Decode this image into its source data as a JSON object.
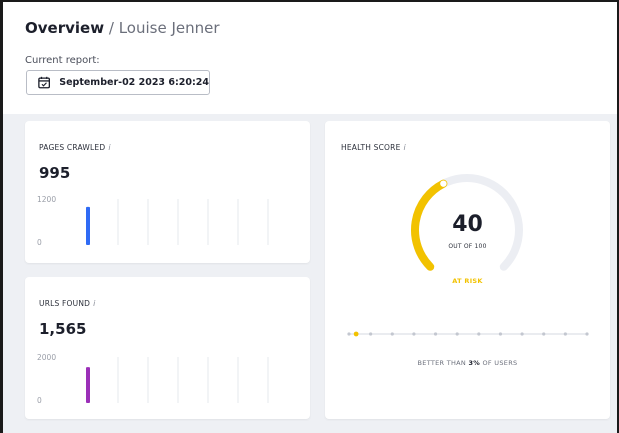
{
  "header": {
    "title": "Overview",
    "separator": "/",
    "user_name": "Louise Jenner",
    "report_label": "Current report:",
    "report_date": "September-02 2023 6:20:24"
  },
  "pages_crawled": {
    "title": "PAGES CRAWLED",
    "info": "i",
    "value": "995",
    "axis_max": "1200",
    "axis_min": "0",
    "bar_color": "#2f6bf5",
    "bar_fraction": 0.83
  },
  "urls_found": {
    "title": "URLS FOUND",
    "info": "i",
    "value": "1,565",
    "axis_max": "2000",
    "axis_min": "0",
    "bar_color": "#9b2fb8",
    "bar_fraction": 0.78
  },
  "health": {
    "title": "HEALTH SCORE",
    "info": "i",
    "score": "40",
    "out_of": "OUT OF 100",
    "status": "AT RISK",
    "status_color": "#f2c200",
    "score_fraction": 0.4,
    "better_prefix": "BETTER THAN",
    "better_value": "3%",
    "better_suffix": "OF USERS",
    "percentile_fraction": 0.03
  },
  "icons": {
    "calendar": "calendar-icon"
  }
}
